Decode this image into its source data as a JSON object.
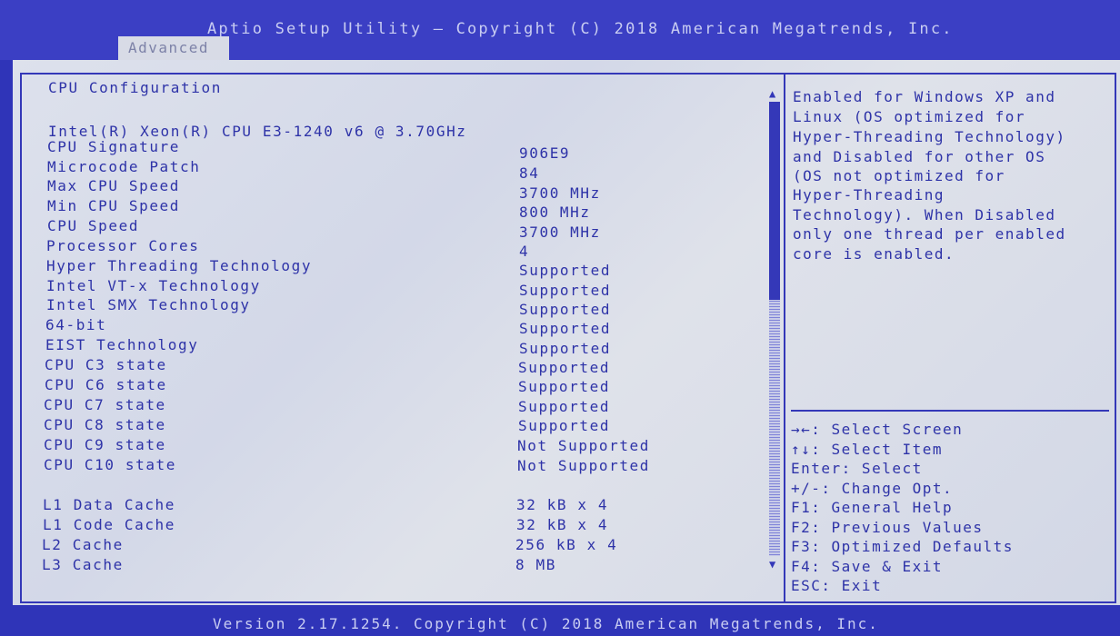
{
  "header": {
    "title": "Aptio Setup Utility – Copyright (C) 2018 American Megatrends, Inc.",
    "tabs": [
      {
        "label": "Advanced"
      }
    ]
  },
  "main": {
    "section_title": "CPU Configuration",
    "processor_name": "Intel(R) Xeon(R) CPU E3-1240 v6 @ 3.70GHz",
    "rows": [
      {
        "label": "CPU Signature",
        "value": "906E9"
      },
      {
        "label": "Microcode Patch",
        "value": "84"
      },
      {
        "label": "Max CPU Speed",
        "value": "3700 MHz"
      },
      {
        "label": "Min CPU Speed",
        "value": "800 MHz"
      },
      {
        "label": "CPU Speed",
        "value": "3700 MHz"
      },
      {
        "label": "Processor Cores",
        "value": "4"
      },
      {
        "label": "Hyper Threading  Technology",
        "value": "Supported"
      },
      {
        "label": "Intel VT-x Technology",
        "value": "Supported"
      },
      {
        "label": "Intel SMX Technology",
        "value": "Supported"
      },
      {
        "label": "64-bit",
        "value": "Supported"
      },
      {
        "label": "EIST Technology",
        "value": "Supported"
      },
      {
        "label": "CPU C3 state",
        "value": "Supported"
      },
      {
        "label": "CPU C6 state",
        "value": "Supported"
      },
      {
        "label": "CPU C7 state",
        "value": "Supported"
      },
      {
        "label": "CPU C8 state",
        "value": "Supported"
      },
      {
        "label": "CPU C9 state",
        "value": "Not Supported"
      },
      {
        "label": "CPU C10 state",
        "value": "Not Supported"
      }
    ],
    "cache_rows": [
      {
        "label": "L1 Data Cache",
        "value": "32 kB x 4"
      },
      {
        "label": "L1 Code Cache",
        "value": "32 kB x 4"
      },
      {
        "label": "L2 Cache",
        "value": "256 kB x 4"
      },
      {
        "label": "L3 Cache",
        "value": "8 MB"
      }
    ]
  },
  "help": {
    "lines": [
      "Enabled for Windows XP and",
      "Linux (OS optimized for",
      "Hyper-Threading Technology)",
      "and Disabled for other OS",
      "(OS not optimized for",
      "Hyper-Threading",
      "Technology). When Disabled",
      "only one thread per enabled",
      "core is enabled."
    ]
  },
  "keys": [
    "→←: Select Screen",
    "↑↓: Select Item",
    "Enter: Select",
    "+/-: Change Opt.",
    "F1: General Help",
    "F2: Previous Values",
    "F3: Optimized Defaults",
    "F4: Save & Exit",
    "ESC: Exit"
  ],
  "scrollbar": {
    "up_glyph": "▲",
    "down_glyph": "▼"
  },
  "footer": {
    "text": "Version 2.17.1254. Copyright (C) 2018 American Megatrends, Inc."
  },
  "colors": {
    "bios_blue": "#3438b8",
    "panel_bg": "#d8dbe6",
    "header_text": "#c9cdf2"
  }
}
